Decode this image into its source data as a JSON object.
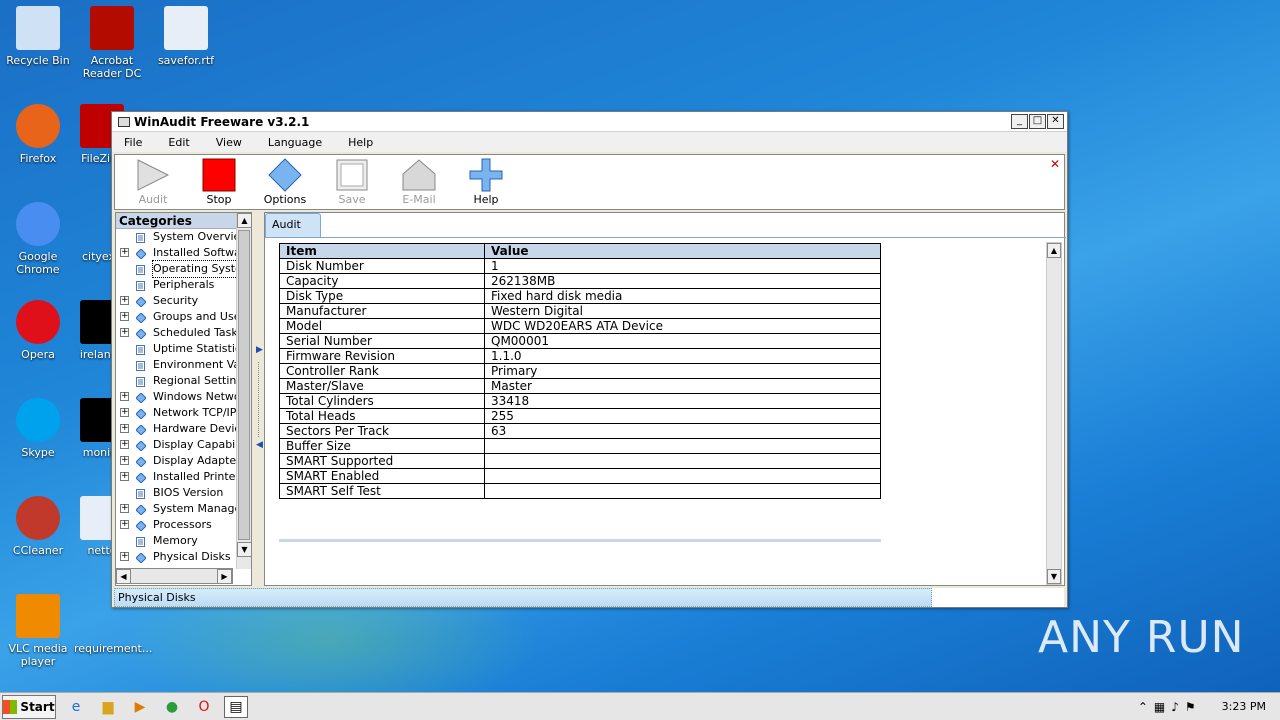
{
  "desktop": {
    "icons": [
      {
        "label": "Recycle Bin",
        "name": "recycle-bin"
      },
      {
        "label": "Acrobat Reader DC",
        "name": "acrobat"
      },
      {
        "label": "savefor.rtf",
        "name": "savefor"
      },
      {
        "label": "Firefox",
        "name": "firefox"
      },
      {
        "label": "FileZilla",
        "name": "filezilla"
      },
      {
        "label": "Google Chrome",
        "name": "chrome"
      },
      {
        "label": "cityexp",
        "name": "cityexp"
      },
      {
        "label": "Opera",
        "name": "opera"
      },
      {
        "label": "irelandy",
        "name": "irelandy"
      },
      {
        "label": "Skype",
        "name": "skype"
      },
      {
        "label": "monito",
        "name": "monito"
      },
      {
        "label": "CCleaner",
        "name": "ccleaner"
      },
      {
        "label": "netto",
        "name": "netto"
      },
      {
        "label": "VLC media player",
        "name": "vlc"
      },
      {
        "label": "requirement...",
        "name": "requirement"
      }
    ]
  },
  "window": {
    "title": "WinAudit Freeware v3.2.1",
    "menu": [
      "File",
      "Edit",
      "View",
      "Language",
      "Help"
    ],
    "toolbar": [
      {
        "label": "Audit",
        "enabled": false
      },
      {
        "label": "Stop",
        "enabled": true
      },
      {
        "label": "Options",
        "enabled": true
      },
      {
        "label": "Save",
        "enabled": false
      },
      {
        "label": "E-Mail",
        "enabled": false
      },
      {
        "label": "Help",
        "enabled": true
      }
    ],
    "categories_title": "Categories",
    "categories": [
      {
        "label": "System Overview",
        "expandable": false
      },
      {
        "label": "Installed Software",
        "expandable": true
      },
      {
        "label": "Operating System",
        "expandable": false,
        "selected": true
      },
      {
        "label": "Peripherals",
        "expandable": false
      },
      {
        "label": "Security",
        "expandable": true
      },
      {
        "label": "Groups and Users",
        "expandable": true
      },
      {
        "label": "Scheduled Tasks",
        "expandable": true
      },
      {
        "label": "Uptime Statistics",
        "expandable": false
      },
      {
        "label": "Environment Varia",
        "expandable": false
      },
      {
        "label": "Regional Settings",
        "expandable": false
      },
      {
        "label": "Windows Network",
        "expandable": true
      },
      {
        "label": "Network TCP/IP",
        "expandable": true
      },
      {
        "label": "Hardware Devices",
        "expandable": true
      },
      {
        "label": "Display Capabilitie",
        "expandable": true
      },
      {
        "label": "Display Adapters",
        "expandable": true
      },
      {
        "label": "Installed Printers",
        "expandable": true
      },
      {
        "label": "BIOS Version",
        "expandable": false
      },
      {
        "label": "System Managem",
        "expandable": true
      },
      {
        "label": "Processors",
        "expandable": true
      },
      {
        "label": "Memory",
        "expandable": false
      },
      {
        "label": "Physical Disks",
        "expandable": true
      }
    ],
    "tab_label": "Audit",
    "table": {
      "headers": [
        "Item",
        "Value"
      ],
      "rows": [
        [
          "Disk Number",
          "1"
        ],
        [
          "Capacity",
          "262138MB"
        ],
        [
          "Disk Type",
          "Fixed hard disk media"
        ],
        [
          "Manufacturer",
          "Western Digital"
        ],
        [
          "Model",
          "WDC WD20EARS ATA Device"
        ],
        [
          "Serial Number",
          "QM00001"
        ],
        [
          "Firmware Revision",
          "1.1.0"
        ],
        [
          "Controller Rank",
          "Primary"
        ],
        [
          "Master/Slave",
          "Master"
        ],
        [
          "Total Cylinders",
          "33418"
        ],
        [
          "Total Heads",
          "255"
        ],
        [
          "Sectors Per Track",
          "63"
        ],
        [
          "Buffer Size",
          ""
        ],
        [
          "SMART Supported",
          ""
        ],
        [
          "SMART Enabled",
          ""
        ],
        [
          "SMART Self Test",
          ""
        ]
      ]
    },
    "status_text": "Physical Disks"
  },
  "taskbar": {
    "start_label": "Start",
    "clock": "3:23 PM"
  },
  "watermark": "ANY RUN"
}
